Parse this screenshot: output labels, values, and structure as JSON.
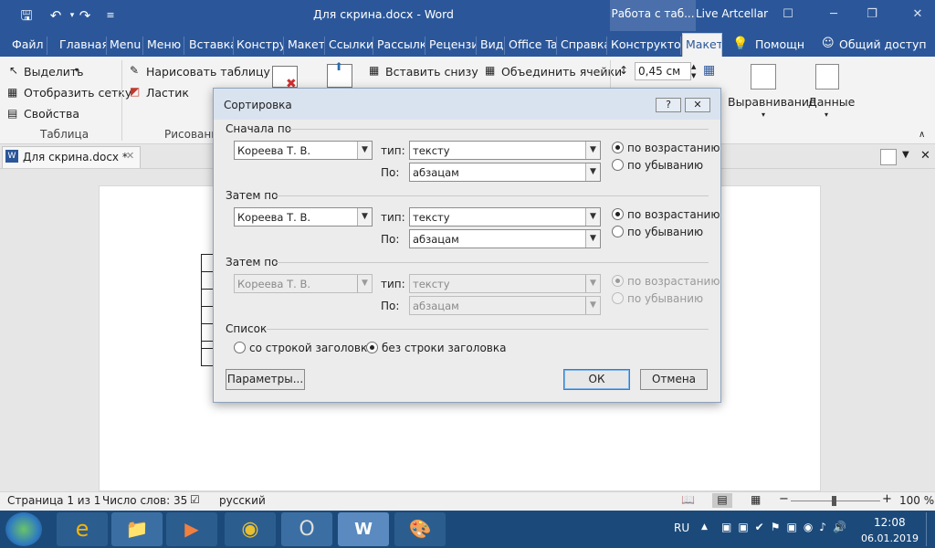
{
  "titlebar": {
    "doc_title": "Для скрина.docx - Word",
    "context_label": "Работа с таб...",
    "account": "Live Artcellar"
  },
  "tabs": [
    "Файл",
    "Главная",
    "Menu",
    "Меню",
    "Вставка",
    "Констру",
    "Макет",
    "Ссылки",
    "Рассылк",
    "Рецензи",
    "Вид",
    "Office Ta",
    "Справка",
    "Конструктор",
    "Макет"
  ],
  "tell_me": "Помощн",
  "share": "Общий доступ",
  "ribbon": {
    "select": "Выделить",
    "grid": "Отобразить сетку",
    "props": "Свойства",
    "group_table": "Таблица",
    "draw_table": "Нарисовать таблицу",
    "eraser": "Ластик",
    "group_draw": "Рисование",
    "insert_below": "Вставить снизу",
    "merge": "Объединить ячейки",
    "height_value": "0,45 см",
    "align": "Выравнивание",
    "data": "Данные"
  },
  "doc_tab": "Для скрина.docx *",
  "dialog": {
    "title": "Сортировка",
    "help": "?",
    "first_label": "Сначала по",
    "then_label": "Затем по",
    "then_label2": "Затем по",
    "field_value": "Кореева Т. В.",
    "type_label": "тип:",
    "type_value": "тексту",
    "by_label": "По:",
    "by_value": "абзацам",
    "asc": "по возрастанию",
    "desc": "по убыванию",
    "list_label": "Список",
    "with_header": "со строкой заголовка",
    "without_header": "без строки заголовка",
    "params_button": "Параметры...",
    "ok_button": "ОК",
    "cancel_button": "Отмена"
  },
  "status": {
    "page": "Страница 1 из 1",
    "words": "Число слов: 35",
    "language": "русский",
    "zoom": "100 %"
  },
  "tray": {
    "lang": "RU",
    "time": "12:08",
    "date": "06.01.2019"
  }
}
